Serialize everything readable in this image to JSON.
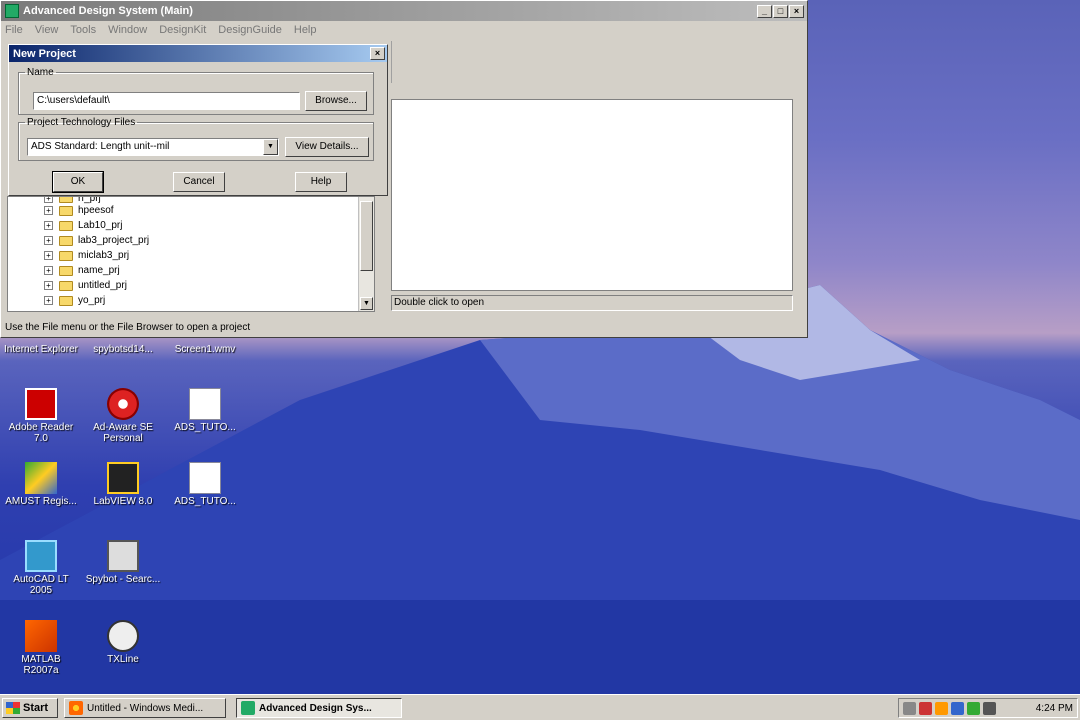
{
  "main_window": {
    "title": "Advanced Design System (Main)",
    "menu": [
      "File",
      "View",
      "Tools",
      "Window",
      "DesignKit",
      "DesignGuide",
      "Help"
    ],
    "title_buttons": [
      "_",
      "□",
      "×"
    ],
    "tree_items": [
      "rf_prj",
      "hpeesof",
      "Lab10_prj",
      "lab3_project_prj",
      "miclab3_prj",
      "name_prj",
      "untitled_prj",
      "yo_prj"
    ],
    "right_status": "Double click to open",
    "status_bar": "Use the File menu or the File Browser to open a project"
  },
  "dialog": {
    "title": "New Project",
    "close": "×",
    "name_group": "Name",
    "name_value": "C:\\users\\default\\",
    "browse_label": "Browse...",
    "tech_group": "Project Technology Files",
    "tech_value": "ADS Standard: Length unit--mil",
    "view_details_label": "View Details...",
    "ok_label": "OK",
    "cancel_label": "Cancel",
    "help_label": "Help"
  },
  "desktop_icons": [
    {
      "label": "Internet Explorer"
    },
    {
      "label": "spybotsd14..."
    },
    {
      "label": "Screen1.wmv"
    },
    {
      "label": "Adobe Reader 7.0"
    },
    {
      "label": "Ad-Aware SE Personal"
    },
    {
      "label": "ADS_TUTO..."
    },
    {
      "label": "AMUST Regis..."
    },
    {
      "label": "LabVIEW 8.0"
    },
    {
      "label": "ADS_TUTO..."
    },
    {
      "label": "AutoCAD LT 2005"
    },
    {
      "label": "Spybot - Searc..."
    },
    {
      "label": "MATLAB R2007a"
    },
    {
      "label": "TXLine"
    }
  ],
  "taskbar": {
    "start_label": "Start",
    "tasks": [
      "Untitled - Windows Medi...",
      "Advanced Design Sys..."
    ],
    "clock": "4:24 PM"
  }
}
